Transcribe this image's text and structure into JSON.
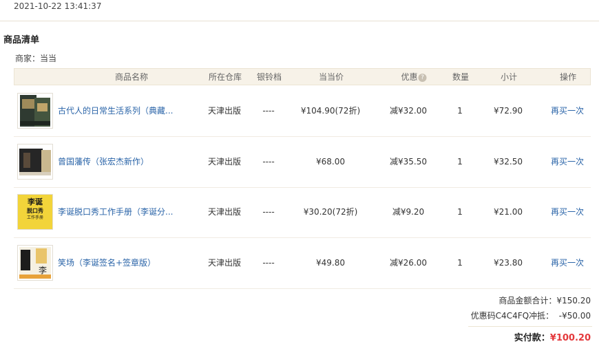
{
  "order": {
    "timestamp": "2021-10-22 13:41:37"
  },
  "section": {
    "title": "商品清单",
    "merchant": "商家：当当"
  },
  "table": {
    "headers": {
      "name": "商品名称",
      "warehouse": "所在仓库",
      "silver_bell": "银铃档",
      "dangdang_price": "当当价",
      "discount": "优惠",
      "quantity": "数量",
      "subtotal": "小计",
      "action": "操作"
    },
    "discount_info_icon": "info-icon",
    "rows": [
      {
        "name": "古代人的日常生活系列（典藏...",
        "warehouse": "天津出版",
        "silver_bell": "----",
        "price": "¥104.90(72折)",
        "discount": "减¥32.00",
        "quantity": "1",
        "subtotal": "¥72.90",
        "action": "再买一次",
        "thumb_icon": "book-cover-icon",
        "thumb_color": "#3d4a3f"
      },
      {
        "name": "曾国藩传（张宏杰新作）",
        "warehouse": "天津出版",
        "silver_bell": "----",
        "price": "¥68.00",
        "discount": "减¥35.50",
        "quantity": "1",
        "subtotal": "¥32.50",
        "action": "再买一次",
        "thumb_icon": "book-cover-icon",
        "thumb_color": "#2b2b2b"
      },
      {
        "name": "李诞脱口秀工作手册（李诞分...",
        "warehouse": "天津出版",
        "silver_bell": "----",
        "price": "¥30.20(72折)",
        "discount": "减¥9.20",
        "quantity": "1",
        "subtotal": "¥21.00",
        "action": "再买一次",
        "thumb_icon": "book-cover-icon",
        "thumb_color": "#f2d43a",
        "thumb_text": [
          "李诞",
          "脱口秀",
          "工作手册"
        ]
      },
      {
        "name": "笑场（李诞签名+签章版）",
        "warehouse": "天津出版",
        "silver_bell": "----",
        "price": "¥49.80",
        "discount": "减¥26.00",
        "quantity": "1",
        "subtotal": "¥23.80",
        "action": "再买一次",
        "thumb_icon": "book-cover-icon",
        "thumb_color": "#f5f0e2"
      }
    ]
  },
  "summary": {
    "goods_total": "商品金额合计：¥150.20",
    "coupon": "优惠码C4C4FQ冲抵：  -¥50.00",
    "paid_label": "实付款：",
    "paid_amount": "¥100.20"
  },
  "colors": {
    "link": "#2a64a8",
    "price_highlight": "#e4393c",
    "header_bg": "#f7f2e8"
  }
}
